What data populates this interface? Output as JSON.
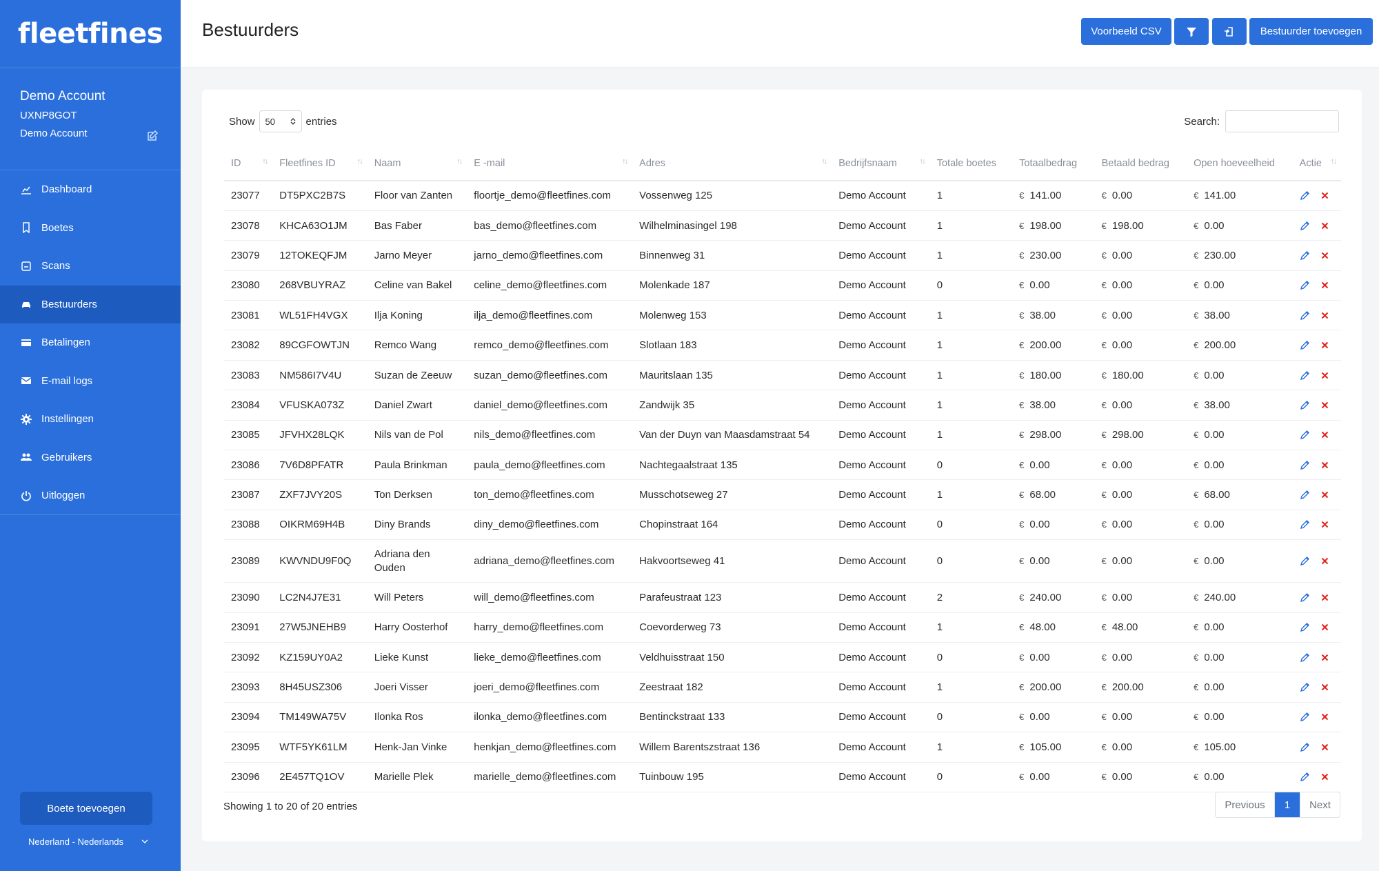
{
  "app": {
    "logo_text": "fleetfines",
    "brand_color": "#2a6fdc"
  },
  "account": {
    "name": "Demo Account",
    "code": "UXNP8GOT",
    "company": "Demo Account"
  },
  "sidebar": {
    "items": [
      {
        "label": "Dashboard",
        "icon": "chart-icon",
        "active": false
      },
      {
        "label": "Boetes",
        "icon": "bookmark-icon",
        "active": false
      },
      {
        "label": "Scans",
        "icon": "scan-icon",
        "active": false
      },
      {
        "label": "Bestuurders",
        "icon": "car-icon",
        "active": true
      },
      {
        "label": "Betalingen",
        "icon": "credit-card-icon",
        "active": false
      },
      {
        "label": "E-mail logs",
        "icon": "envelope-icon",
        "active": false
      },
      {
        "label": "Instellingen",
        "icon": "gear-icon",
        "active": false
      },
      {
        "label": "Gebruikers",
        "icon": "users-icon",
        "active": false
      },
      {
        "label": "Uitloggen",
        "icon": "power-icon",
        "active": false
      }
    ],
    "add_fine_label": "Boete toevoegen",
    "language": "Nederland - Nederlands"
  },
  "header": {
    "title": "Bestuurders",
    "csv_label": "Voorbeeld CSV",
    "add_driver_label": "Bestuurder toevoegen"
  },
  "table_controls": {
    "show_label": "Show",
    "entries_value": "50",
    "entries_label": "entries",
    "search_label": "Search:"
  },
  "columns": [
    "ID",
    "Fleetfines ID",
    "Naam",
    "E -mail",
    "Adres",
    "Bedrijfsnaam",
    "Totale boetes",
    "Totaalbedrag",
    "Betaald bedrag",
    "Open hoeveelheid",
    "Actie"
  ],
  "currency": "€",
  "rows": [
    [
      "23077",
      "DT5PXC2B7S",
      "Floor van Zanten",
      "floortje_demo@fleetfines.com",
      "Vossenweg 125",
      "Demo Account",
      "1",
      "141.00",
      "0.00",
      "141.00"
    ],
    [
      "23078",
      "KHCA63O1JM",
      "Bas Faber",
      "bas_demo@fleetfines.com",
      "Wilhelminasingel 198",
      "Demo Account",
      "1",
      "198.00",
      "198.00",
      "0.00"
    ],
    [
      "23079",
      "12TOKEQFJM",
      "Jarno Meyer",
      "jarno_demo@fleetfines.com",
      "Binnenweg 31",
      "Demo Account",
      "1",
      "230.00",
      "0.00",
      "230.00"
    ],
    [
      "23080",
      "268VBUYRAZ",
      "Celine van Bakel",
      "celine_demo@fleetfines.com",
      "Molenkade 187",
      "Demo Account",
      "0",
      "0.00",
      "0.00",
      "0.00"
    ],
    [
      "23081",
      "WL51FH4VGX",
      "Ilja Koning",
      "ilja_demo@fleetfines.com",
      "Molenweg 153",
      "Demo Account",
      "1",
      "38.00",
      "0.00",
      "38.00"
    ],
    [
      "23082",
      "89CGFOWTJN",
      "Remco Wang",
      "remco_demo@fleetfines.com",
      "Slotlaan 183",
      "Demo Account",
      "1",
      "200.00",
      "0.00",
      "200.00"
    ],
    [
      "23083",
      "NM586I7V4U",
      "Suzan de Zeeuw",
      "suzan_demo@fleetfines.com",
      "Mauritslaan 135",
      "Demo Account",
      "1",
      "180.00",
      "180.00",
      "0.00"
    ],
    [
      "23084",
      "VFUSKA073Z",
      "Daniel Zwart",
      "daniel_demo@fleetfines.com",
      "Zandwijk 35",
      "Demo Account",
      "1",
      "38.00",
      "0.00",
      "38.00"
    ],
    [
      "23085",
      "JFVHX28LQK",
      "Nils van de Pol",
      "nils_demo@fleetfines.com",
      "Van der Duyn van Maasdamstraat 54",
      "Demo Account",
      "1",
      "298.00",
      "298.00",
      "0.00"
    ],
    [
      "23086",
      "7V6D8PFATR",
      "Paula Brinkman",
      "paula_demo@fleetfines.com",
      "Nachtegaalstraat 135",
      "Demo Account",
      "0",
      "0.00",
      "0.00",
      "0.00"
    ],
    [
      "23087",
      "ZXF7JVY20S",
      "Ton Derksen",
      "ton_demo@fleetfines.com",
      "Musschotseweg 27",
      "Demo Account",
      "1",
      "68.00",
      "0.00",
      "68.00"
    ],
    [
      "23088",
      "OIKRM69H4B",
      "Diny Brands",
      "diny_demo@fleetfines.com",
      "Chopinstraat 164",
      "Demo Account",
      "0",
      "0.00",
      "0.00",
      "0.00"
    ],
    [
      "23089",
      "KWVNDU9F0Q",
      "Adriana den Ouden",
      "adriana_demo@fleetfines.com",
      "Hakvoortseweg 41",
      "Demo Account",
      "0",
      "0.00",
      "0.00",
      "0.00"
    ],
    [
      "23090",
      "LC2N4J7E31",
      "Will Peters",
      "will_demo@fleetfines.com",
      "Parafeustraat 123",
      "Demo Account",
      "2",
      "240.00",
      "0.00",
      "240.00"
    ],
    [
      "23091",
      "27W5JNEHB9",
      "Harry Oosterhof",
      "harry_demo@fleetfines.com",
      "Coevorderweg 73",
      "Demo Account",
      "1",
      "48.00",
      "48.00",
      "0.00"
    ],
    [
      "23092",
      "KZ159UY0A2",
      "Lieke Kunst",
      "lieke_demo@fleetfines.com",
      "Veldhuisstraat 150",
      "Demo Account",
      "0",
      "0.00",
      "0.00",
      "0.00"
    ],
    [
      "23093",
      "8H45USZ306",
      "Joeri Visser",
      "joeri_demo@fleetfines.com",
      "Zeestraat 182",
      "Demo Account",
      "1",
      "200.00",
      "200.00",
      "0.00"
    ],
    [
      "23094",
      "TM149WA75V",
      "Ilonka Ros",
      "ilonka_demo@fleetfines.com",
      "Bentinckstraat 133",
      "Demo Account",
      "0",
      "0.00",
      "0.00",
      "0.00"
    ],
    [
      "23095",
      "WTF5YK61LM",
      "Henk-Jan Vinke",
      "henkjan_demo@fleetfines.com",
      "Willem Barentszstraat 136",
      "Demo Account",
      "1",
      "105.00",
      "0.00",
      "105.00"
    ],
    [
      "23096",
      "2E457TQ1OV",
      "Marielle Plek",
      "marielle_demo@fleetfines.com",
      "Tuinbouw 195",
      "Demo Account",
      "0",
      "0.00",
      "0.00",
      "0.00"
    ]
  ],
  "footer": {
    "info": "Showing 1 to 20 of 20 entries",
    "prev_label": "Previous",
    "page": "1",
    "next_label": "Next"
  }
}
